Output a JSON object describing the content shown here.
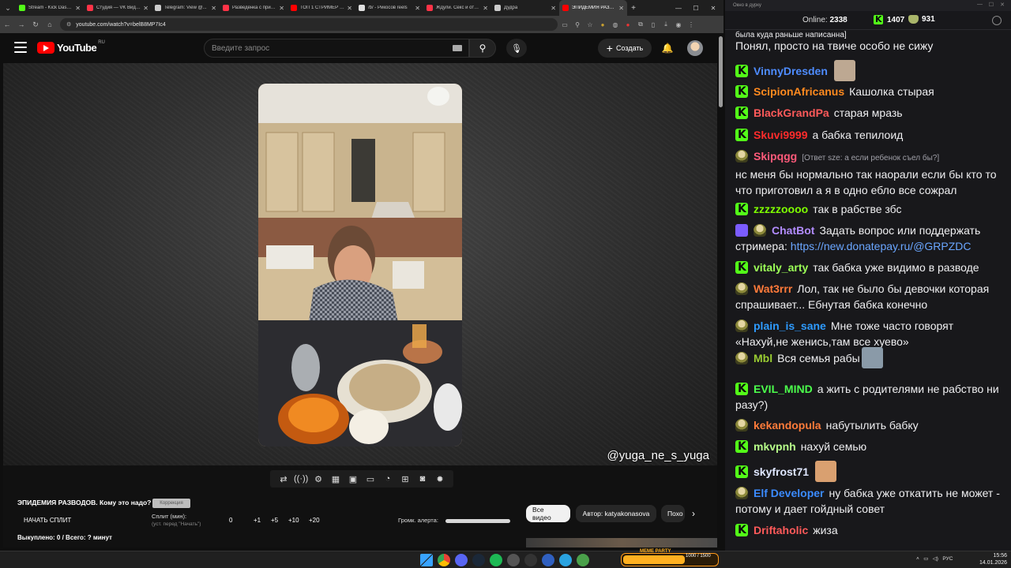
{
  "browser": {
    "tabs": [
      {
        "title": "Stream - Kick Dashboard",
        "color": "#53fc18",
        "active": false
      },
      {
        "title": "Студия — VK Видео",
        "color": "#ff3347",
        "active": false
      },
      {
        "title": "Telegram: View @...",
        "color": "#cccccc",
        "active": false
      },
      {
        "title": "Разведёнка с прицепом",
        "color": "#ff3347",
        "active": false
      },
      {
        "title": "ТОП 1 СТРИМЕР В...",
        "color": "#ff0000",
        "active": false
      },
      {
        "title": "/b/ - Рикосов reels",
        "color": "#e0e0e0",
        "active": false
      },
      {
        "title": "Ждули. Секс и отн...",
        "color": "#ff3347",
        "active": false
      },
      {
        "title": "Дудра",
        "color": "#cccccc",
        "active": false
      },
      {
        "title": "ЭПИДЕМИЯ РАЗВОД...",
        "color": "#ff0000",
        "active": true
      }
    ],
    "url": "youtube.com/watch?v=belB8MP7Ic4"
  },
  "youtube": {
    "logo_text": "YouTube",
    "region": "RU",
    "search_placeholder": "Введите запрос",
    "create_label": "Создать"
  },
  "video": {
    "watermark": "@yuga_ne_s_yuga"
  },
  "panel": {
    "title": "ЭПИДЕМИЯ РАЗВОДОВ. Кому это надо?",
    "correction_btn": "Коррекция",
    "start_split": "НАЧАТЬ СПЛИТ",
    "split_label": "Сплит (мин):",
    "split_hint": "(уст. перед \"Начать\")",
    "split_steps": [
      "0",
      "+1",
      "+5",
      "+10",
      "+20"
    ],
    "bought": "Выкуплено: 0 / Всего: ? минут",
    "alert_volume": "Громк. алерта:",
    "chips": [
      "Все видео",
      "Автор: katyakonasova",
      "Похо"
    ]
  },
  "chat": {
    "window_title": "Окно в дурку",
    "online_label": "Online:",
    "online_count": "2338",
    "kick_viewers": "1407",
    "other_viewers": "931",
    "messages": [
      {
        "badge": "",
        "user": "",
        "color": "",
        "reply": "",
        "text": "была куда раньше написанна]",
        "small": true
      },
      {
        "badge": "",
        "user": "",
        "color": "",
        "reply": "",
        "text": "Понял, просто на твиче особо не сижу"
      },
      {
        "badge": "k",
        "user": "VinnyDresden",
        "color": "#4e8cff",
        "reply": "",
        "text": "",
        "emote": "#bda892"
      },
      {
        "badge": "k",
        "user": "ScipionAfricanus",
        "color": "#ff8a1f",
        "reply": "",
        "text": "Кашолка стырая"
      },
      {
        "badge": "k",
        "user": "BlackGrandPa",
        "color": "#ff5a5a",
        "reply": "",
        "text": "старая мразь"
      },
      {
        "badge": "k",
        "user": "Skuvi9999",
        "color": "#ff2b2b",
        "reply": "",
        "text": "а бабка тепилоид"
      },
      {
        "badge": "h",
        "user": "Skipqgg",
        "color": "#ff5a7a",
        "reply": "[Ответ sze: а если ребенок съел бы?]",
        "text": "нс меня бы нормально так наорали если бы кто то что приготовил а я в одно ебло все сожрал"
      },
      {
        "badge": "k",
        "user": "zzzzzoooo",
        "color": "#7fff00",
        "reply": "",
        "text": "так в рабстве збс"
      },
      {
        "badge": "b",
        "user": "ChatBot",
        "color": "#b28cff",
        "reply": "",
        "text": "Задать вопрос или поддержать стримера:",
        "link": "https://new.donatepay.ru/@GRPZDC"
      },
      {
        "badge": "k",
        "user": "vitaly_arty",
        "color": "#9cff57",
        "reply": "",
        "text": "так бабка уже видимо в разводе"
      },
      {
        "badge": "h",
        "user": "Wat3rrr",
        "color": "#ff7a3a",
        "reply": "",
        "text": "Лол, так не было бы девочки которая спрашивает... Ебнутая бабка конечно"
      },
      {
        "badge": "h",
        "user": "plain_is_sane",
        "color": "#2e9bff",
        "reply": "",
        "text": "Мне тоже часто говорят «Нахуй,не женись,там все хуево»"
      },
      {
        "badge": "h",
        "user": "Mbl",
        "color": "#9acd32",
        "reply": "",
        "text": "Вся семья рабы",
        "emote": "#8a9aa8"
      },
      {
        "badge": "k",
        "user": "EVIL_MIND",
        "color": "#4cff4c",
        "reply": "",
        "text": "а жить с родителями не рабство ни разу?)"
      },
      {
        "badge": "h",
        "user": "kekandopula",
        "color": "#ff7b3a",
        "reply": "",
        "text": "набутылить бабку"
      },
      {
        "badge": "k",
        "user": "mkvpnh",
        "color": "#b8ff8a",
        "reply": "",
        "text": "нахуй семью"
      },
      {
        "badge": "k",
        "user": "skyfrost71",
        "color": "#dfe7ff",
        "reply": "",
        "text": "",
        "emote": "#d9a070"
      },
      {
        "badge": "h",
        "user": "Elf Developer",
        "color": "#3b8bff",
        "reply": "",
        "text": "ну бабка уже откатить не может - потому и дает гойдный совет"
      },
      {
        "badge": "k",
        "user": "Driftaholic",
        "color": "#ff5a5a",
        "reply": "",
        "text": "жиза"
      }
    ]
  },
  "taskbar": {
    "meme_title": "MEME PARTY",
    "meme_text": "1000 / 1500",
    "meme_progress": 0.66,
    "tray_lang": "РУС",
    "time": "15:56",
    "date": "14.01.2026"
  }
}
